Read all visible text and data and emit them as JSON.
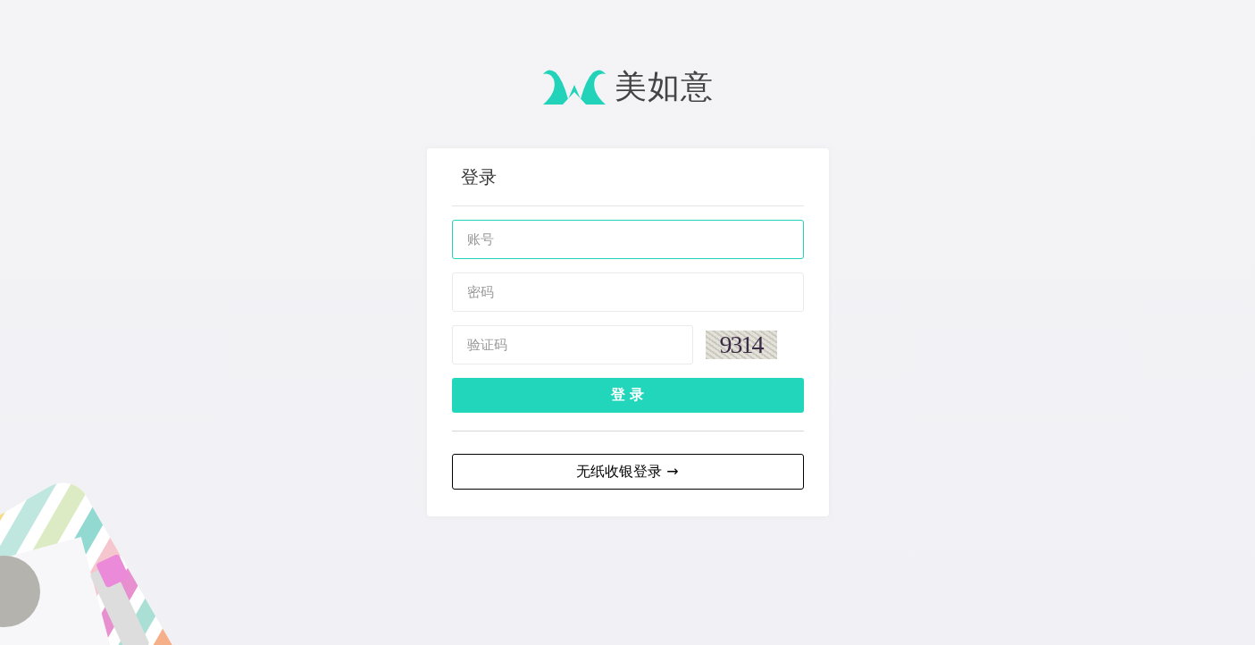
{
  "logo": {
    "text": "美如意"
  },
  "login_card": {
    "title": "登录",
    "fields": [
      {
        "placeholder": "账号",
        "focused": true
      },
      {
        "placeholder": "密码",
        "focused": false
      }
    ],
    "captcha": {
      "placeholder": "验证码",
      "code": "9314"
    },
    "submit_button": "登 录",
    "paperless_button": "无纸收银登录 →"
  }
}
